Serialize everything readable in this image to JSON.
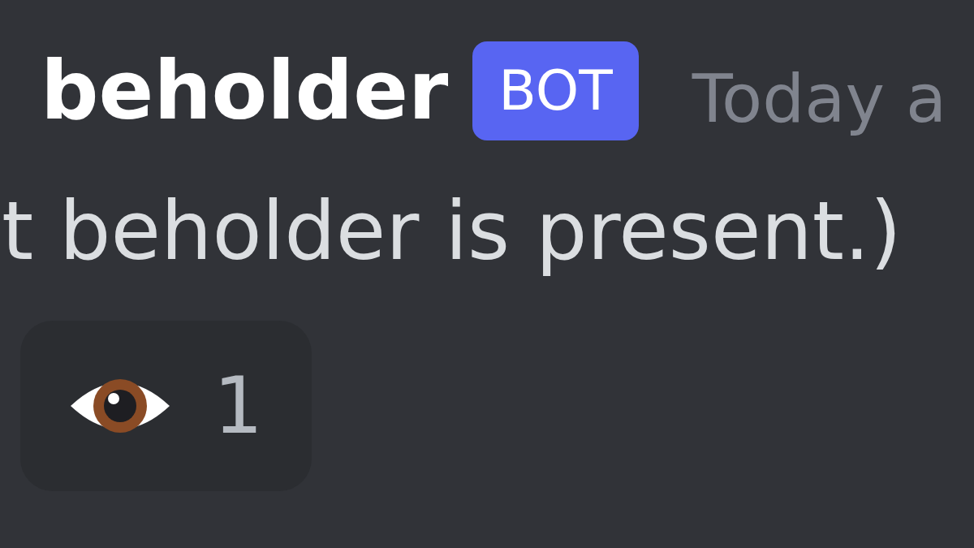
{
  "message": {
    "author": "beholder",
    "badge": "BOT",
    "timestamp": "Today a",
    "text": "t beholder is present.)"
  },
  "reactions": [
    {
      "count": "1",
      "selected": false
    }
  ]
}
